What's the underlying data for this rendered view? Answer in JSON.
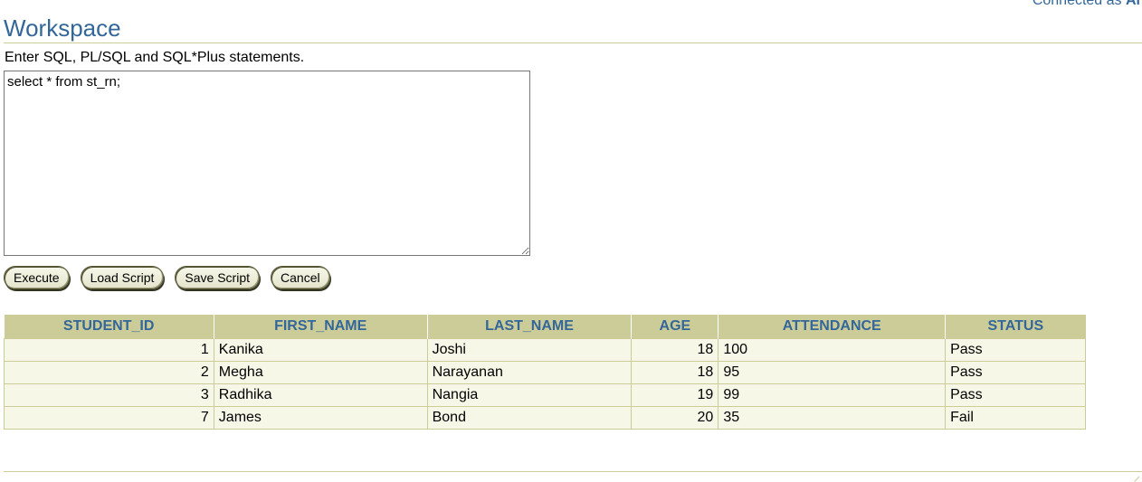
{
  "header": {
    "connected_prefix": "Connected as",
    "connected_user": "Al"
  },
  "workspace": {
    "title": "Workspace",
    "instructions": "Enter SQL, PL/SQL and SQL*Plus statements.",
    "sql_text": "select * from st_rn;"
  },
  "buttons": {
    "execute": "Execute",
    "load_script": "Load Script",
    "save_script": "Save Script",
    "cancel": "Cancel"
  },
  "colors": {
    "accent": "#336699",
    "header_bg": "#cccc99",
    "row_bg": "#f7f7e7"
  },
  "results": {
    "columns": [
      "STUDENT_ID",
      "FIRST_NAME",
      "LAST_NAME",
      "AGE",
      "ATTENDANCE",
      "STATUS"
    ],
    "rows": [
      [
        "1",
        "Kanika",
        "Joshi",
        "18",
        "100",
        "Pass"
      ],
      [
        "2",
        "Megha",
        "Narayanan",
        "18",
        "95",
        "Pass"
      ],
      [
        "3",
        "Radhika",
        "Nangia",
        "19",
        "99",
        "Pass"
      ],
      [
        "7",
        "James",
        "Bond",
        "20",
        "35",
        "Fail"
      ]
    ]
  }
}
